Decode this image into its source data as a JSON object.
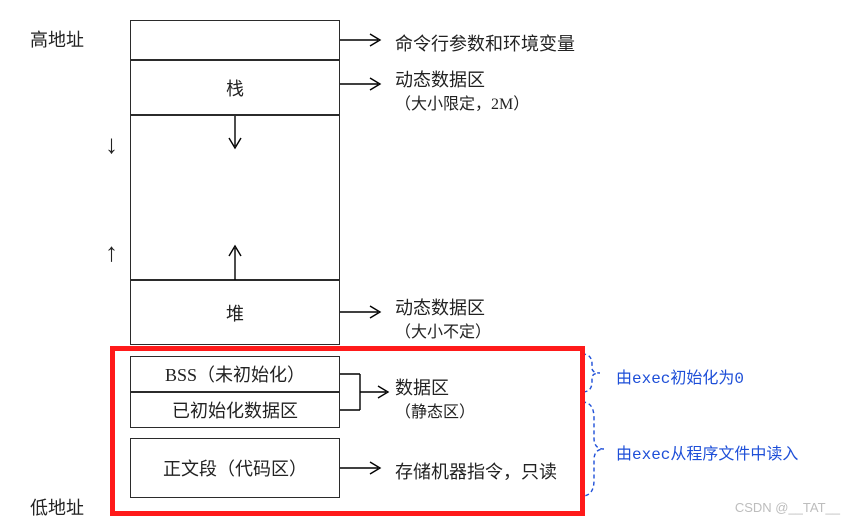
{
  "labels": {
    "high_addr": "高地址",
    "low_addr": "低地址"
  },
  "segments": {
    "cmdline": "",
    "stack": "栈",
    "gap": "",
    "heap": "堆",
    "bss": "BSS（未初始化）",
    "data": "已初始化数据区",
    "text": "正文段（代码区）"
  },
  "notes": {
    "cmdline": "命令行参数和环境变量",
    "stack1": "动态数据区",
    "stack2": "（大小限定，2M）",
    "heap1": "动态数据区",
    "heap2": "（大小不定）",
    "dataarea1": "数据区",
    "dataarea2": "（静态区）",
    "text1": "存储机器指令，只读"
  },
  "brace_notes": {
    "bss": "由exec初始化为0",
    "text": "由exec从程序文件中读入"
  },
  "arrows": {
    "down": "↓",
    "up": "↑"
  },
  "watermark": "CSDN @__TAT__"
}
